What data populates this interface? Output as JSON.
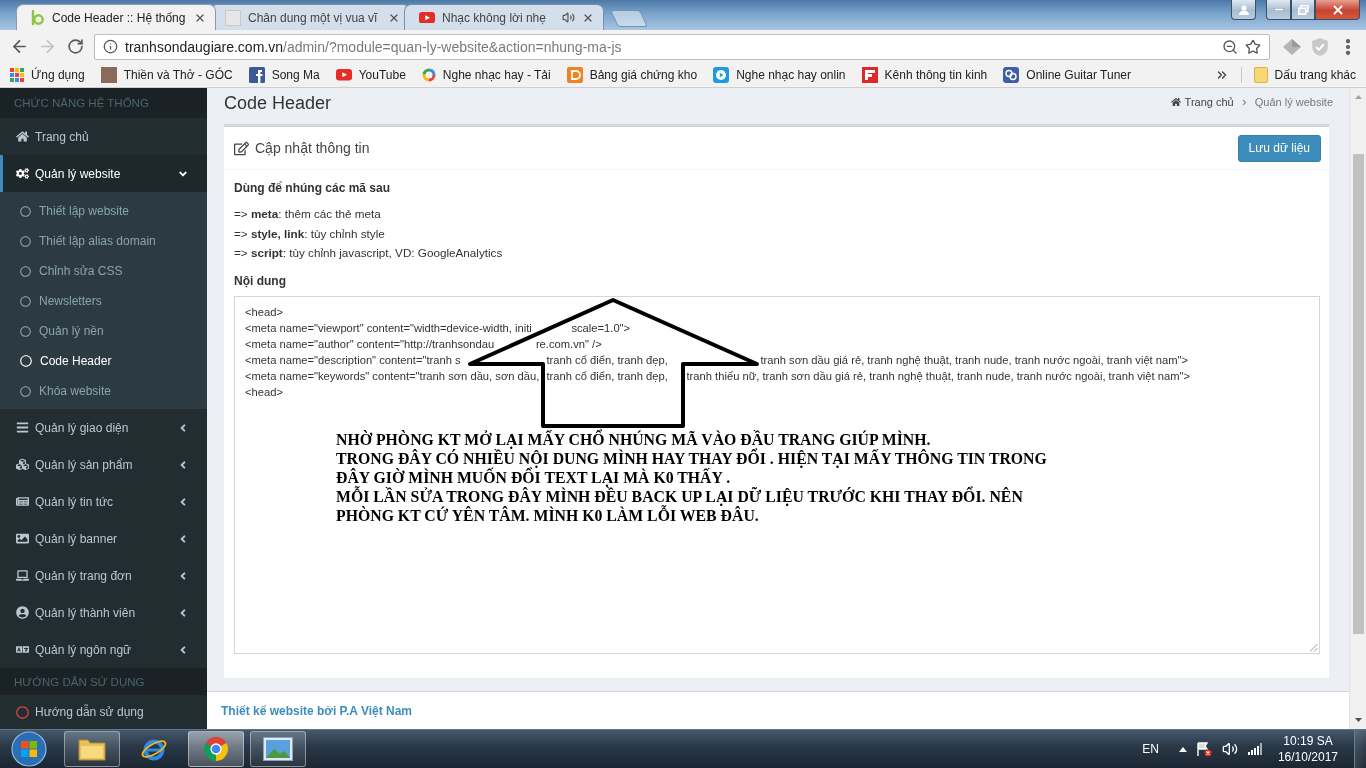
{
  "tabs": [
    {
      "title": "Code Header :: Hệ thống",
      "selected": true,
      "audio": false
    },
    {
      "title": "Chân dung một vị vua vĩ",
      "selected": false,
      "audio": false
    },
    {
      "title": "Nhạc không lời nhẹ",
      "selected": false,
      "audio": true
    }
  ],
  "toolbar": {
    "back_enabled": true,
    "forward_enabled": false,
    "url_host": "tranhsondaugiare.com.vn",
    "url_path": "/admin/?module=quan-ly-website&action=nhung-ma-js"
  },
  "bookmarks": [
    "Ứng dụng",
    "Thiền và Thở - GÓC",
    "Song Ma",
    "YouTube",
    "Nghe nhạc hay - Tải",
    "Bảng giá chứng kho",
    "Nghe nhạc hay onlin",
    "Kênh thông tin kinh",
    "Online Guitar Tuner"
  ],
  "other_bookmarks": "Dấu trang khác",
  "sidebar": {
    "sections": [
      {
        "header": "CHỨC NĂNG HỆ THỐNG",
        "items": [
          {
            "label": "Trang chủ",
            "selected": false
          },
          {
            "label": "Quản lý website",
            "selected": true,
            "expanded": true,
            "children": [
              {
                "label": "Thiết lập website",
                "selected": false
              },
              {
                "label": "Thiết lập alias domain",
                "selected": false
              },
              {
                "label": "Chỉnh sửa CSS",
                "selected": false
              },
              {
                "label": "Newsletters",
                "selected": false
              },
              {
                "label": "Quản lý nền",
                "selected": false
              },
              {
                "label": "Code Header",
                "selected": true
              },
              {
                "label": "Khóa website",
                "selected": false
              }
            ]
          },
          {
            "label": "Quản lý giao diện",
            "selected": false,
            "expanded": false
          },
          {
            "label": "Quản lý sản phẩm",
            "selected": false,
            "expanded": false
          },
          {
            "label": "Quản lý tin tức",
            "selected": false,
            "expanded": false
          },
          {
            "label": "Quản lý banner",
            "selected": false,
            "expanded": false
          },
          {
            "label": "Quản lý trang đơn",
            "selected": false,
            "expanded": false
          },
          {
            "label": "Quản lý thành viên",
            "selected": false,
            "expanded": false
          },
          {
            "label": "Quản lý ngôn ngữ",
            "selected": false,
            "expanded": false
          }
        ]
      },
      {
        "header": "HƯỚNG DẪN SỬ DỤNG",
        "items": [
          {
            "label": "Hướng dẫn sử dụng",
            "selected": false
          }
        ]
      }
    ]
  },
  "content_header": {
    "title": "Code Header",
    "breadcrumb": [
      "Trang chủ",
      "Quản lý website"
    ]
  },
  "panel": {
    "title": "Cập nhật thông tin",
    "save_button": "Lưu dữ liệu",
    "help_title": "Dùng để nhúng các mã sau",
    "help_lines": [
      "=> **meta**: thêm các thẻ meta",
      "=> **style, link**: tùy chỉnh style",
      "=> **script**: tùy chỉnh javascript, VD: GoogleAnalytics"
    ],
    "field_label": "Nội dung",
    "code_lines": [
      [
        "<head>"
      ],
      [
        "<meta name=\"viewport\" content=\"width=device-width, initi",
        "scale=1.0\">"
      ],
      [
        "<meta name=\"author\" content=\"http://tranhsondau",
        "re.com.vn\" />"
      ],
      [
        "<meta name=\"description\" content=\"tranh s",
        "tranh cổ điển, tranh đẹp,",
        "tranh sơn dầu giá rẻ, tranh nghệ thuật, tranh nude, tranh nước ngoài, tranh việt nam\">"
      ],
      [
        "<meta name=\"keywords\" content=\"tranh sơn dầu, sơn dầu,",
        "tranh cổ điển, tranh đẹp,",
        "tranh thiếu nữ, tranh sơn dầu giá rẻ, tranh nghệ thuật, tranh nude, tranh nước ngoài, tranh việt nam\">"
      ],
      [
        "<head>"
      ]
    ]
  },
  "annotation": {
    "lines": [
      "NHỜ PHÒNG KT MỞ LẠI MẤY CHỔ NHÚNG MÃ VÀO ĐẦU TRANG GIÚP MÌNH.",
      "TRONG ĐÂY CÓ NHIỀU NỘI DUNG MÌNH HAY THAY ĐỔI . HIỆN TẠI MẤY THÔNG TIN TRONG",
      "ĐÂY GIỜ MÌNH MUỐN ĐỔI TEXT LẠI MÀ K0 THẤY .",
      "MỖI LẦN SỬA TRONG ĐÂY MÌNH ĐỀU BACK UP LẠI DỮ LIỆU TRƯỚC KHI THAY ĐỔI. NÊN",
      "PHÒNG KT CỨ YÊN TÂM. MÌNH K0 LÀM LỖI WEB ĐÂU."
    ]
  },
  "footer": {
    "credit": "Thiết kế website bởi P.A Việt Nam"
  },
  "taskbar": {
    "apps": [
      {
        "running": true,
        "selected": false
      },
      {
        "running": false,
        "selected": false
      },
      {
        "running": true,
        "selected": true
      },
      {
        "running": true,
        "selected": false
      }
    ],
    "language": "EN",
    "time": "10:19 SA",
    "date": "16/10/2017"
  }
}
